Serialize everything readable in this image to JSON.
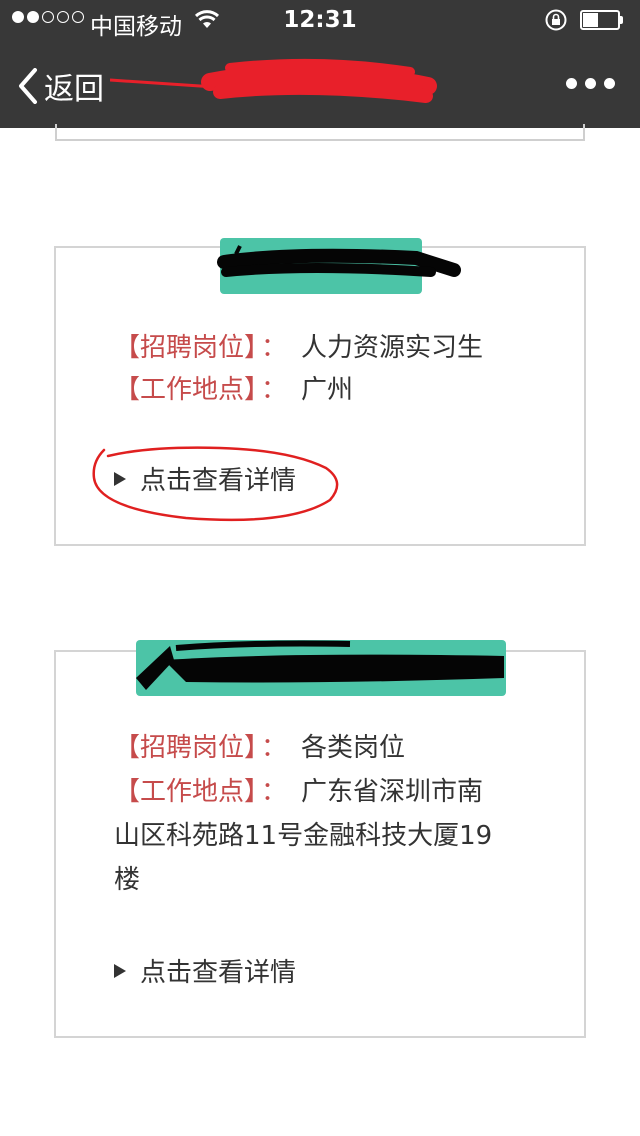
{
  "status_bar": {
    "carrier": "中国移动",
    "time": "12:31",
    "battery_level": 0.45
  },
  "nav": {
    "back_label": "返回"
  },
  "colors": {
    "bar_bg": "#383838",
    "accent_red": "#c64b4b",
    "badge_teal": "#4cc4a7",
    "annotation_red": "#e02020"
  },
  "jobs": [
    {
      "position_label": "【招聘岗位】",
      "colon": "：",
      "position": "人力资源实习生",
      "location_label": "【工作地点】",
      "location": "广州",
      "detail_label": "点击查看详情"
    },
    {
      "position_label": "【招聘岗位】",
      "colon": "：",
      "position": "各类岗位",
      "location_label": "【工作地点】",
      "location_line1": "广东省深圳市南",
      "location_line2": "山区科苑路11号金融科技大厦19",
      "location_line3": "楼",
      "detail_label": "点击查看详情"
    }
  ]
}
